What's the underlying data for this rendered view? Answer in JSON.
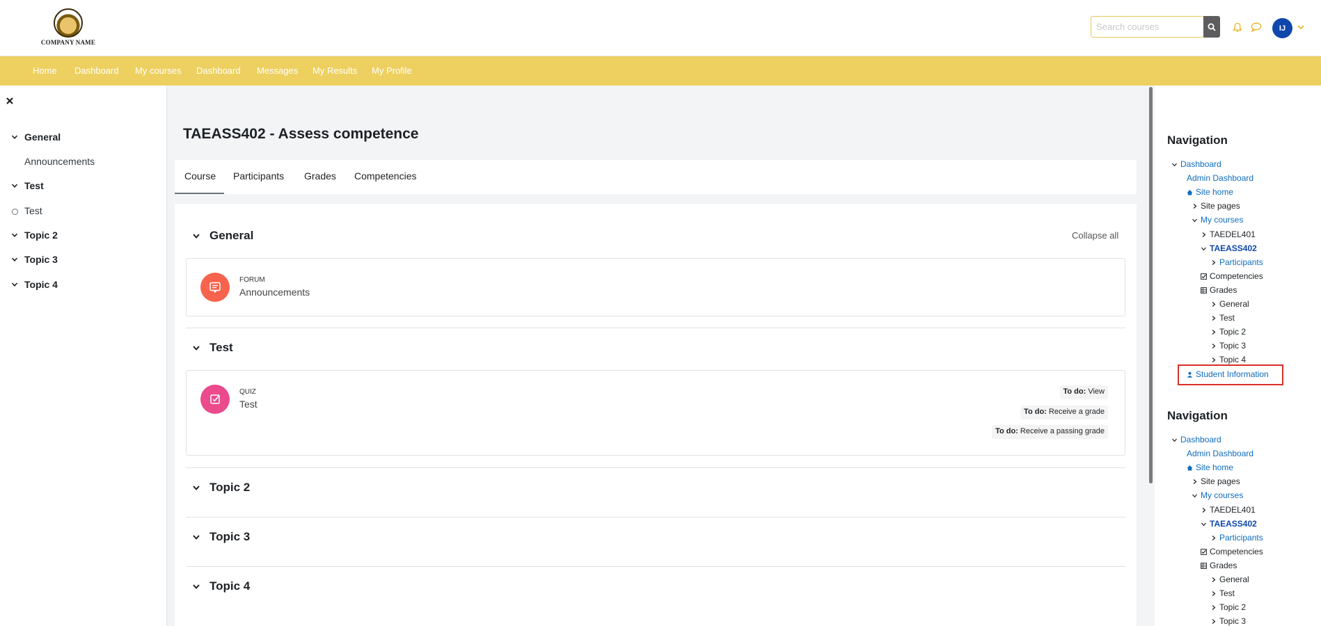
{
  "header": {
    "logo_text": "COMPANY NAME",
    "search_placeholder": "Search courses",
    "user_initials": "IJ",
    "icons": [
      "search-icon",
      "bell-icon",
      "chat-icon",
      "chevron-down-icon"
    ]
  },
  "navbar": {
    "items": [
      "Home",
      "Dashboard",
      "My courses",
      "Dashboard",
      "Messages",
      "My Results",
      "My Profile"
    ]
  },
  "drawer": {
    "items": [
      {
        "label": "General",
        "kind": "section"
      },
      {
        "label": "Announcements",
        "kind": "activity"
      },
      {
        "label": "Test",
        "kind": "section"
      },
      {
        "label": "Test",
        "kind": "activity-circle"
      },
      {
        "label": "Topic 2",
        "kind": "section"
      },
      {
        "label": "Topic 3",
        "kind": "section"
      },
      {
        "label": "Topic 4",
        "kind": "section"
      }
    ]
  },
  "course": {
    "title": "TAEASS402 - Assess competence",
    "tabs": [
      "Course",
      "Participants",
      "Grades",
      "Competencies"
    ],
    "collapse_all": "Collapse all",
    "sections": [
      {
        "name": "General",
        "activity": {
          "type": "FORUM",
          "name": "Announcements",
          "color": "#f7634d"
        }
      },
      {
        "name": "Test",
        "activity": {
          "type": "QUIZ",
          "name": "Test",
          "color": "#eb4a8c",
          "todos": [
            {
              "label": "To do:",
              "value": "View"
            },
            {
              "label": "To do:",
              "value": "Receive a grade"
            },
            {
              "label": "To do:",
              "value": "Receive a passing grade"
            }
          ]
        }
      },
      {
        "name": "Topic 2"
      },
      {
        "name": "Topic 3"
      },
      {
        "name": "Topic 4"
      }
    ]
  },
  "navigation_blocks": [
    {
      "title": "Navigation",
      "items": [
        {
          "label": "Dashboard",
          "style": "link",
          "icon": "chevron-down-icon"
        },
        {
          "label": "Admin Dashboard",
          "style": "link",
          "icon": ""
        },
        {
          "label": "Site home",
          "style": "link",
          "icon": "home-icon"
        },
        {
          "label": "Site pages",
          "style": "plain",
          "icon": "chevron-right-icon"
        },
        {
          "label": "My courses",
          "style": "link",
          "icon": "chevron-down-icon"
        },
        {
          "label": "TAEDEL401",
          "style": "plain",
          "icon": "chevron-right-icon"
        },
        {
          "label": "TAEASS402",
          "style": "strong",
          "icon": "chevron-down-icon"
        },
        {
          "label": "Participants",
          "style": "link",
          "icon": "chevron-right-icon"
        },
        {
          "label": "Competencies",
          "style": "plain",
          "icon": "checkbox-icon"
        },
        {
          "label": "Grades",
          "style": "plain",
          "icon": "table-icon"
        },
        {
          "label": "General",
          "style": "plain",
          "icon": "chevron-right-icon"
        },
        {
          "label": "Test",
          "style": "plain",
          "icon": "chevron-right-icon"
        },
        {
          "label": "Topic 2",
          "style": "plain",
          "icon": "chevron-right-icon"
        },
        {
          "label": "Topic 3",
          "style": "plain",
          "icon": "chevron-right-icon"
        },
        {
          "label": "Topic 4",
          "style": "plain",
          "icon": "chevron-right-icon"
        },
        {
          "label": "Student Information",
          "style": "link",
          "icon": "user-icon"
        }
      ]
    },
    {
      "title": "Navigation",
      "items": [
        {
          "label": "Dashboard",
          "style": "link",
          "icon": "chevron-down-icon"
        },
        {
          "label": "Admin Dashboard",
          "style": "link",
          "icon": ""
        },
        {
          "label": "Site home",
          "style": "link",
          "icon": "home-icon"
        },
        {
          "label": "Site pages",
          "style": "plain",
          "icon": "chevron-right-icon"
        },
        {
          "label": "My courses",
          "style": "link",
          "icon": "chevron-down-icon"
        },
        {
          "label": "TAEDEL401",
          "style": "plain",
          "icon": "chevron-right-icon"
        },
        {
          "label": "TAEASS402",
          "style": "strong",
          "icon": "chevron-down-icon"
        },
        {
          "label": "Participants",
          "style": "link",
          "icon": "chevron-right-icon"
        },
        {
          "label": "Competencies",
          "style": "plain",
          "icon": "checkbox-icon"
        },
        {
          "label": "Grades",
          "style": "plain",
          "icon": "table-icon"
        },
        {
          "label": "General",
          "style": "plain",
          "icon": "chevron-right-icon"
        },
        {
          "label": "Test",
          "style": "plain",
          "icon": "chevron-right-icon"
        },
        {
          "label": "Topic 2",
          "style": "plain",
          "icon": "chevron-right-icon"
        },
        {
          "label": "Topic 3",
          "style": "plain",
          "icon": "chevron-right-icon"
        }
      ]
    }
  ],
  "colors": {
    "navbar": "#edd060",
    "accent_icon": "#e6b422",
    "avatar": "#0f47ad",
    "link": "#0f6cbf",
    "highlight": "#d9302a"
  }
}
